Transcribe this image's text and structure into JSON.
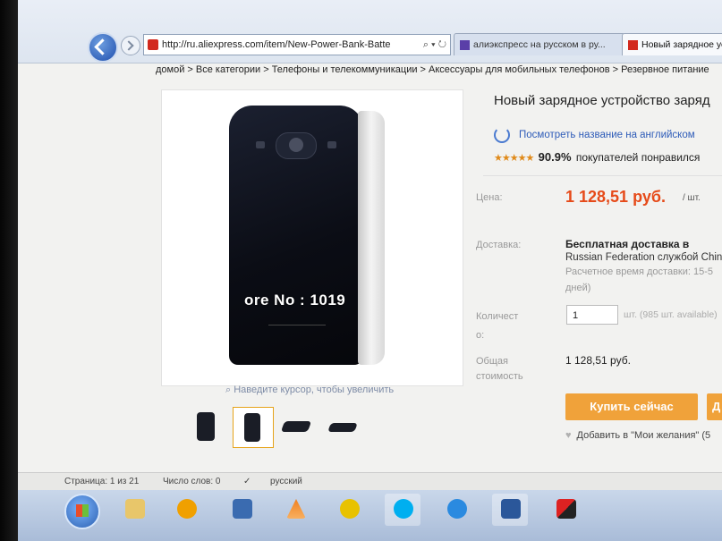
{
  "browser": {
    "url": "http://ru.aliexpress.com/item/New-Power-Bank-Batte",
    "tab1_title": "алиэкспресс на русском в ру...",
    "tab2_title": "Новый зарядное устр",
    "tools": "⌕ ▾ ↻"
  },
  "breadcrumb": "домой > Все категории > Телефоны и телекоммуникации > Аксессуары для мобильных телефонов > Резервное питание",
  "gallery": {
    "watermark": "ore No : 1019",
    "zoom_hint": "Наведите курсор, чтобы увеличить",
    "thumbnail_count": 4,
    "selected_thumbnail": 2
  },
  "product": {
    "title": "Новый зарядное устройство заряд",
    "english_link": "Посмотреть название на английском",
    "rating_stars": "★★★★★",
    "rating_percent": "90.9%",
    "rating_text": "покупателей понравился",
    "price_label": "Цена:",
    "price": "1 128,51 руб.",
    "price_unit": "/ шт.",
    "delivery_label": "Доставка:",
    "delivery_line1": "Бесплатная доставка в",
    "delivery_line2": "Russian Federation службой Chin",
    "delivery_line3": "Расчетное время доставки: 15-5",
    "delivery_line4": "дней)",
    "qty_label_1": "Количест",
    "qty_label_2": "о:",
    "qty_value": "1",
    "qty_available": "шт. (985 шт. available)",
    "total_label_1": "Общая",
    "total_label_2": "стоимость",
    "total_value": "1 128,51 руб.",
    "buy_now": "Купить сейчас",
    "add_to_cart_partial": "Д",
    "wishlist": "Добавить в \"Мои желания\" (5"
  },
  "statusbar": {
    "page": "Страница: 1 из 21",
    "words": "Число слов: 0",
    "lang": "русский"
  },
  "colors": {
    "price": "#e64a19",
    "button": "#f0a23a",
    "link": "#2d5bb8"
  }
}
